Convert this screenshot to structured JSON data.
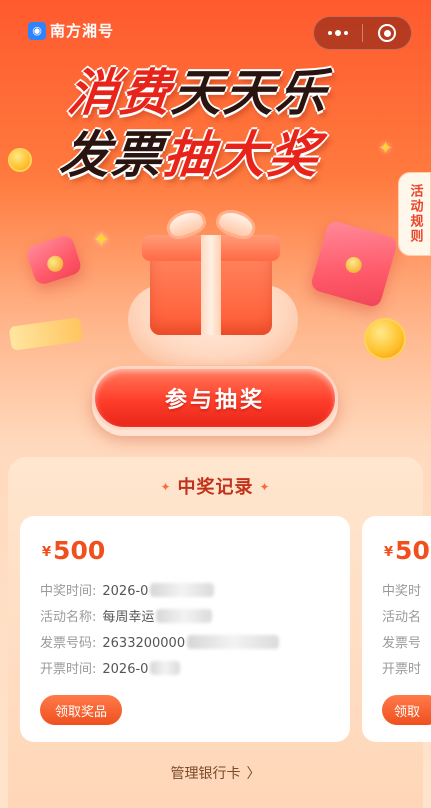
{
  "brand": {
    "icon": "nanfang-app-icon",
    "name": "南方湘号"
  },
  "capsule": {
    "menu_icon": "more-dots-icon",
    "close_icon": "target-circle-icon"
  },
  "hero": {
    "line1_part1": "消费",
    "line1_part2": "天天乐",
    "line2_part1": "发票",
    "line2_part2": "抽大奖"
  },
  "side_tab": {
    "label": "活动规则"
  },
  "cta": {
    "label": "参与抽奖"
  },
  "records": {
    "title": "中奖记录",
    "cards": [
      {
        "currency": "¥",
        "amount": "500",
        "win_time_label": "中奖时间:",
        "win_time_value": "2026-0",
        "activity_label": "活动名称:",
        "activity_value": "每周幸运",
        "invoice_no_label": "发票号码:",
        "invoice_no_value": "2633200000",
        "issue_time_label": "开票时间:",
        "issue_time_value": "2026-0",
        "claim_label": "领取奖品"
      },
      {
        "currency": "¥",
        "amount": "50",
        "win_time_label": "中奖时",
        "activity_label": "活动名",
        "invoice_no_label": "发票号",
        "issue_time_label": "开票时",
        "claim_label": "领取"
      }
    ],
    "manage_link": "管理银行卡"
  },
  "colors": {
    "accent": "#f0501e",
    "title_red": "#c2321a",
    "hero_red": "#e8241a",
    "hero_dark": "#2a1410"
  }
}
